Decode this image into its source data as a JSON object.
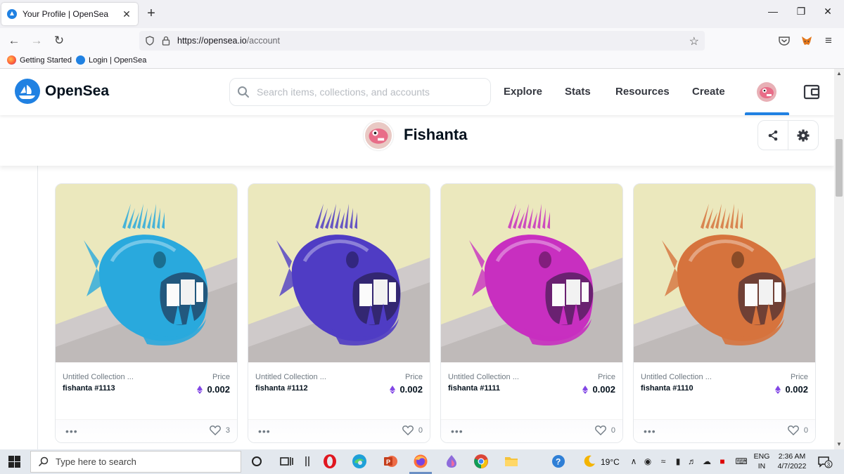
{
  "browser": {
    "tab_title": "Your Profile | OpenSea",
    "tab_close": "✕",
    "new_tab": "+",
    "url_host": "https://opensea.io",
    "url_path": "/account",
    "bookmarks": [
      "Getting Started",
      "Login | OpenSea"
    ]
  },
  "opensea": {
    "brand": "OpenSea",
    "search_placeholder": "Search items, collections, and accounts",
    "nav": [
      "Explore",
      "Stats",
      "Resources",
      "Create"
    ],
    "accent_color": "#2081e2"
  },
  "profile": {
    "name": "Fishanta"
  },
  "cards": [
    {
      "collection": "Untitled Collection ...",
      "name": "fishanta #1113",
      "price_label": "Price",
      "price": "0.002",
      "likes": "3",
      "fish_color": "#29a9dd"
    },
    {
      "collection": "Untitled Collection ...",
      "name": "fishanta #1112",
      "price_label": "Price",
      "price": "0.002",
      "likes": "0",
      "fish_color": "#4f3cc4"
    },
    {
      "collection": "Untitled Collection ...",
      "name": "fishanta #1111",
      "price_label": "Price",
      "price": "0.002",
      "likes": "0",
      "fish_color": "#c82fc0"
    },
    {
      "collection": "Untitled Collection ...",
      "name": "fishanta #1110",
      "price_label": "Price",
      "price": "0.002",
      "likes": "0",
      "fish_color": "#d6733d"
    }
  ],
  "taskbar": {
    "search_placeholder": "Type here to search",
    "temperature": "19°C",
    "language": [
      "ENG",
      "IN"
    ],
    "time": "2:36 AM",
    "date": "4/7/2022",
    "notification_count": "3"
  }
}
